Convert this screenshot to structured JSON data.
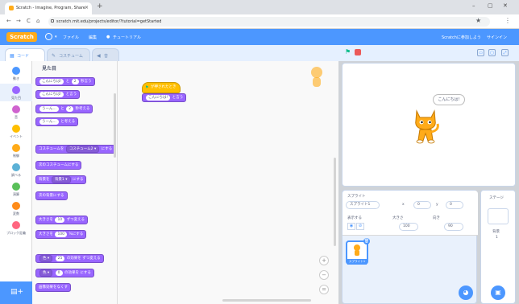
{
  "browser": {
    "tab_title": "Scratch - Imagine, Program, Share",
    "tab_close": "×",
    "new_tab": "+",
    "url": "scratch.mit.edu/projects/editor/?tutorial=getStarted",
    "back": "←",
    "forward": "→",
    "reload": "C",
    "home": "⌂",
    "star": "★",
    "menu": "⋮",
    "minimize": "–",
    "maximize": "▢",
    "close": "✕"
  },
  "menubar": {
    "logo": "Scratch",
    "file": "ファイル",
    "edit": "編集",
    "tutorials": "チュートリアル",
    "join": "Scratchに参加しよう",
    "signin": "サインイン"
  },
  "editor_tabs": {
    "code": "コード",
    "costumes": "コスチューム",
    "sounds": "音"
  },
  "categories": [
    {
      "label": "動き",
      "color": "#4c97ff"
    },
    {
      "label": "見た目",
      "color": "#9966ff"
    },
    {
      "label": "音",
      "color": "#cf63cf"
    },
    {
      "label": "イベント",
      "color": "#ffbf00"
    },
    {
      "label": "制御",
      "color": "#ffab19"
    },
    {
      "label": "調べる",
      "color": "#5cb1d6"
    },
    {
      "label": "演算",
      "color": "#59c059"
    },
    {
      "label": "変数",
      "color": "#ff8c1a"
    },
    {
      "label": "ブロック定義",
      "color": "#ff6680"
    }
  ],
  "palette": {
    "title": "見た目",
    "blocks": [
      {
        "pre": "",
        "pill": "こんにちは!",
        "mid": "と",
        "pill2": "2",
        "post": "秒言う"
      },
      {
        "pre": "",
        "pill": "こんにちは!",
        "mid": "と言う",
        "pill2": "",
        "post": ""
      },
      {
        "pre": "",
        "pill": "うーん...",
        "mid": "と",
        "pill2": "2",
        "post": "秒考える"
      },
      {
        "pre": "",
        "pill": "うーん...",
        "mid": "と考える",
        "pill2": "",
        "post": ""
      },
      {
        "pre": "コスチュームを",
        "dpill": "コスチューム2 ▾",
        "post": "にする"
      },
      {
        "pre": "次のコスチュームにする",
        "post": ""
      },
      {
        "pre": "背景を",
        "dpill": "背景1 ▾",
        "post": "にする"
      },
      {
        "pre": "次の背景にする",
        "post": ""
      },
      {
        "pre": "大きさを",
        "pill": "10",
        "post": "ずつ変える"
      },
      {
        "pre": "大きさを",
        "pill": "100",
        "post": "%にする"
      },
      {
        "pre": "",
        "dpill": "色 ▾",
        "mid": "の効果を",
        "pill": "25",
        "post": "ずつ変える"
      },
      {
        "pre": "",
        "dpill": "色 ▾",
        "mid": "の効果を",
        "pill": "0",
        "post": "にする"
      },
      {
        "pre": "画像効果をなくす",
        "post": ""
      }
    ]
  },
  "code": {
    "hat": "が押されたとき",
    "say_pill": "こんにちは!",
    "say_post": "と言う"
  },
  "stage": {
    "speech": "こんにちは!"
  },
  "sprite_info": {
    "sprite_label": "スプライト",
    "sprite_name": "スプライト1",
    "x_label": "x",
    "x_value": "0",
    "y_label": "y",
    "y_value": "0",
    "show_label": "表示する",
    "size_label": "大きさ",
    "size_value": "100",
    "direction_label": "向き",
    "direction_value": "90",
    "thumb_name": "スプライト1"
  },
  "stage_pane": {
    "title": "ステージ",
    "backdrops_label": "背景",
    "backdrops_count": "1"
  },
  "zoom": {
    "in": "+",
    "out": "−",
    "reset": "="
  },
  "colors": {
    "accent": "#4c97ff",
    "looks": "#9966ff",
    "events": "#ffbf00"
  }
}
